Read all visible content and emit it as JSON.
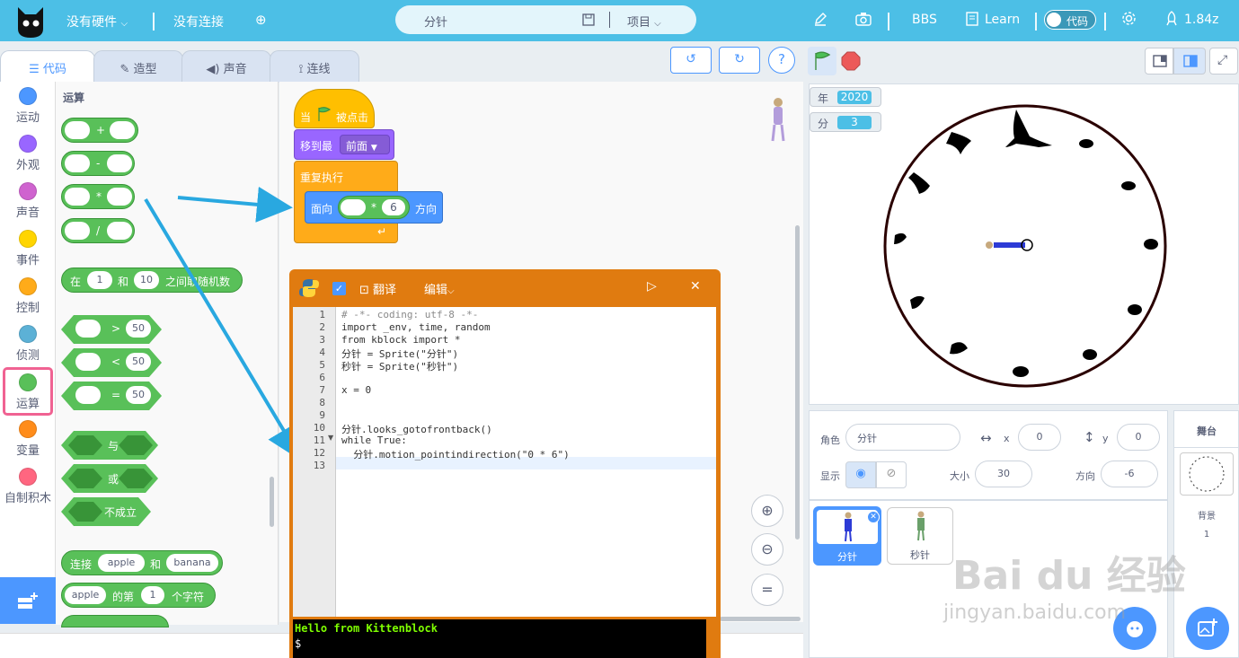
{
  "topbar": {
    "hardware": "没有硬件",
    "connection": "没有连接",
    "project_name": "分针",
    "project_menu": "项目",
    "bbs": "BBS",
    "learn": "Learn",
    "code_toggle": "代码",
    "version": "1.84z"
  },
  "tabs": {
    "code": "代码",
    "costumes": "造型",
    "sounds": "声音",
    "wires": "连线"
  },
  "categories": [
    {
      "label": "运动",
      "color": "#4c97ff"
    },
    {
      "label": "外观",
      "color": "#9966ff"
    },
    {
      "label": "声音",
      "color": "#cf63cf"
    },
    {
      "label": "事件",
      "color": "#ffd500"
    },
    {
      "label": "控制",
      "color": "#ffab19"
    },
    {
      "label": "侦测",
      "color": "#5cb1d6"
    },
    {
      "label": "运算",
      "color": "#59c059"
    },
    {
      "label": "变量",
      "color": "#ff8c1a"
    },
    {
      "label": "自制积木",
      "color": "#ff6680"
    }
  ],
  "palette": {
    "heading": "运算",
    "op_plus": "+",
    "op_minus": "-",
    "op_times": "*",
    "op_div": "/",
    "random_in": "在",
    "random_and": "和",
    "random_tail": "之间取随机数",
    "random_a": "1",
    "random_b": "10",
    "gt": ">",
    "lt": "<",
    "eq": "=",
    "cmp_val": "50",
    "and": "与",
    "or": "或",
    "not": "不成立",
    "join": "连接",
    "join_a": "apple",
    "join_and": "和",
    "join_b": "banana",
    "letter_a": "apple",
    "letter_of": "的第",
    "letter_n": "1",
    "letter_tail": "个字符"
  },
  "script": {
    "when": "当",
    "clicked": "被点击",
    "goto": "移到最",
    "goto_opt": "前面",
    "forever": "重复执行",
    "point": "面向",
    "point_op": "*",
    "point_val": "6",
    "point_tail": "方向"
  },
  "editor": {
    "translate": "翻译",
    "edit": "编辑",
    "lines": [
      {
        "n": "1",
        "text": "# -*- coding: utf-8 -*-",
        "color": "#8a8a8a"
      },
      {
        "n": "2",
        "text": "import _env, time, random",
        "color": "#333333"
      },
      {
        "n": "3",
        "text": "from kblock import *",
        "color": "#333333"
      },
      {
        "n": "4",
        "text": "分针 = Sprite(\"分针\")",
        "color": "#333333"
      },
      {
        "n": "5",
        "text": "秒针 = Sprite(\"秒针\")",
        "color": "#333333"
      },
      {
        "n": "6",
        "text": "",
        "color": "#333333"
      },
      {
        "n": "7",
        "text": "x = 0",
        "color": "#333333"
      },
      {
        "n": "8",
        "text": "",
        "color": "#333333"
      },
      {
        "n": "9",
        "text": "",
        "color": "#333333"
      },
      {
        "n": "10",
        "text": "分针.looks_gotofrontback()",
        "color": "#333333"
      },
      {
        "n": "11",
        "text": "while True:",
        "color": "#333333"
      },
      {
        "n": "12",
        "text": "  分针.motion_pointindirection(\"0 * 6\")",
        "color": "#333333"
      },
      {
        "n": "13",
        "text": "",
        "color": "#333333"
      }
    ],
    "terminal_line1": "Hello from Kittenblock",
    "terminal_line2": "$"
  },
  "monitors": {
    "year_label": "年",
    "year_value": "2020",
    "minute_label": "分",
    "minute_value": "3"
  },
  "sprite_info": {
    "sprite_label": "角色",
    "sprite_name": "分针",
    "x_label": "x",
    "x_value": "0",
    "y_label": "y",
    "y_value": "0",
    "show_label": "显示",
    "size_label": "大小",
    "size_value": "30",
    "direction_label": "方向",
    "direction_value": "-6"
  },
  "sprites": [
    {
      "name": "分针"
    },
    {
      "name": "秒针"
    }
  ],
  "stage_panel": {
    "title": "舞台",
    "backdrop_label": "背景",
    "backdrop_count": "1"
  },
  "watermark": {
    "line1": "Bai du 经验",
    "line2": "jingyan.baidu.com"
  }
}
